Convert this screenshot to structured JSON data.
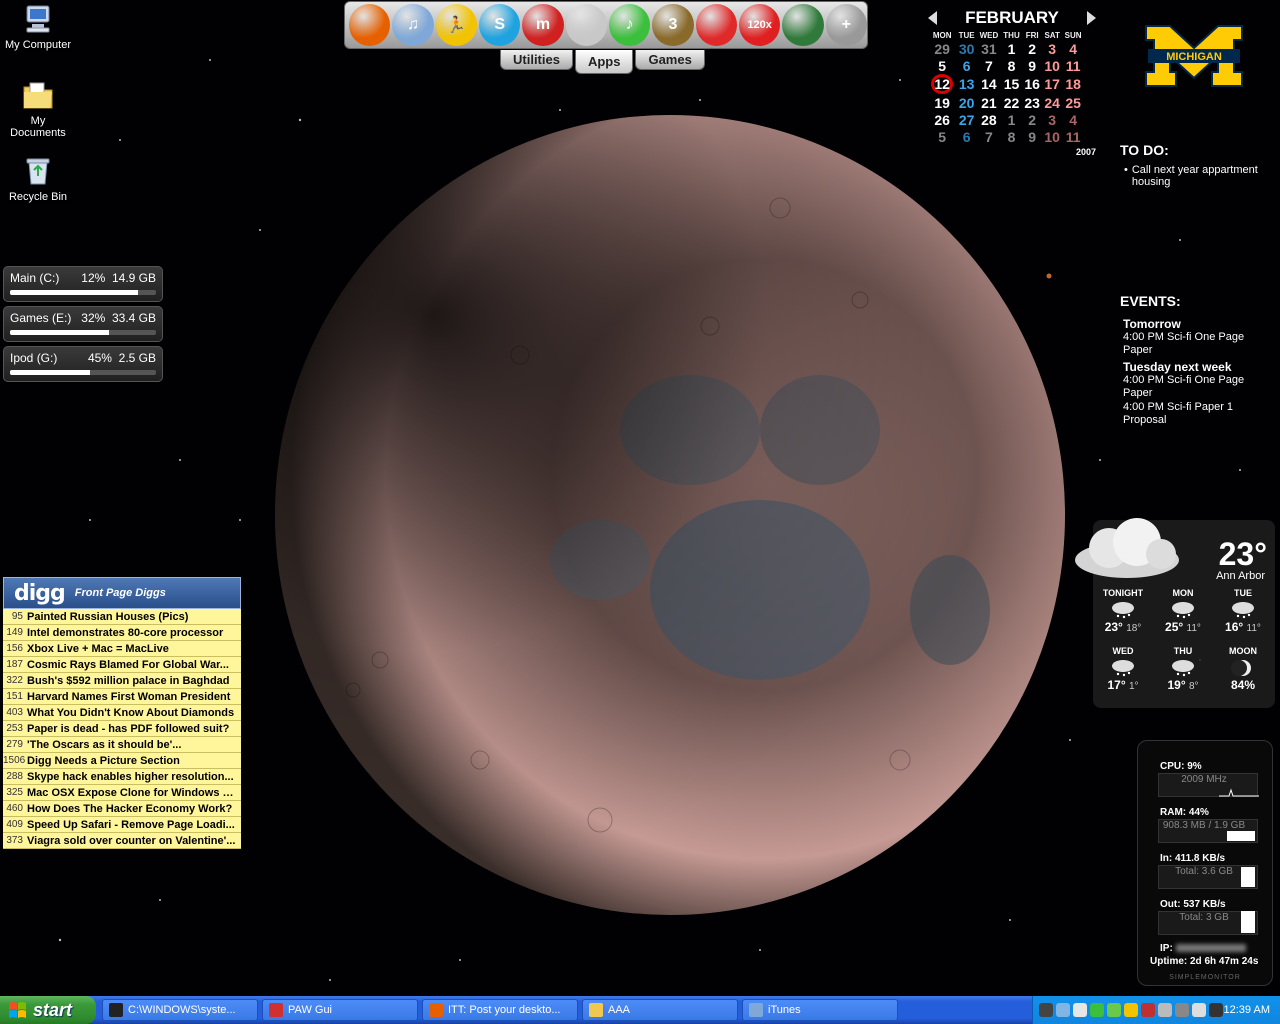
{
  "desktop_icons": [
    {
      "label": "My Computer",
      "icon": "my-computer-icon"
    },
    {
      "label": "My Documents",
      "icon": "my-documents-icon"
    },
    {
      "label": "Recycle Bin",
      "icon": "recycle-bin-icon"
    }
  ],
  "drives": [
    {
      "name": "Main (C:)",
      "percent_text": "12%",
      "size": "14.9 GB",
      "fill": 0.88
    },
    {
      "name": "Games (E:)",
      "percent_text": "32%",
      "size": "33.4 GB",
      "fill": 0.68
    },
    {
      "name": "Ipod (G:)",
      "percent_text": "45%",
      "size": "2.5 GB",
      "fill": 0.55
    }
  ],
  "digg": {
    "logo": "digg",
    "subtitle": "Front Page Diggs",
    "items": [
      {
        "count": "95",
        "title": "Painted Russian Houses (Pics)"
      },
      {
        "count": "149",
        "title": "Intel demonstrates 80-core processor"
      },
      {
        "count": "156",
        "title": "Xbox Live + Mac = MacLive"
      },
      {
        "count": "187",
        "title": "Cosmic Rays Blamed For Global War..."
      },
      {
        "count": "322",
        "title": "Bush's $592 million palace in Baghdad"
      },
      {
        "count": "151",
        "title": "Harvard Names First Woman President"
      },
      {
        "count": "403",
        "title": "What You Didn't Know About Diamonds"
      },
      {
        "count": "253",
        "title": "Paper is dead - has PDF followed suit?"
      },
      {
        "count": "279",
        "title": "'The Oscars as it should be'..."
      },
      {
        "count": "1506",
        "title": "Digg Needs a Picture Section"
      },
      {
        "count": "288",
        "title": "Skype hack enables higher resolution..."
      },
      {
        "count": "325",
        "title": "Mac OSX Expose Clone for Windows V..."
      },
      {
        "count": "460",
        "title": "How Does The Hacker Economy Work?"
      },
      {
        "count": "409",
        "title": "Speed Up Safari - Remove Page Loadi..."
      },
      {
        "count": "373",
        "title": "Viagra sold over counter on Valentine'..."
      }
    ]
  },
  "dock": {
    "apps": [
      {
        "name": "firefox-icon",
        "color": "#e66000",
        "glyph": ""
      },
      {
        "name": "itunes-icon",
        "color": "#7fa8d8",
        "glyph": "♫"
      },
      {
        "name": "aim-icon",
        "color": "#f2c300",
        "glyph": "🏃"
      },
      {
        "name": "skype-icon",
        "color": "#1fa3e0",
        "glyph": "S"
      },
      {
        "name": "mirc-icon",
        "color": "#d02020",
        "glyph": "m"
      },
      {
        "name": "headset-icon",
        "color": "#c8c8c8",
        "glyph": ""
      },
      {
        "name": "jetaudio-icon",
        "color": "#3cbf3c",
        "glyph": "♪"
      },
      {
        "name": "film-icon",
        "color": "#8a6a2a",
        "glyph": "3"
      },
      {
        "name": "audition-icon",
        "color": "#e02a2a",
        "glyph": ""
      },
      {
        "name": "acrobat-icon",
        "color": "#e02020",
        "glyph": "120x"
      },
      {
        "name": "globe-icon",
        "color": "#2f7a3a",
        "glyph": ""
      },
      {
        "name": "add-icon",
        "color": "#999999",
        "glyph": "+"
      }
    ],
    "tabs": [
      "Utilities",
      "Apps",
      "Games"
    ],
    "active_tab": "Apps"
  },
  "calendar": {
    "month": "FEBRUARY",
    "year": "2007",
    "weekdays": [
      "MON",
      "TUE",
      "WED",
      "THU",
      "FRI",
      "SAT",
      "SUN"
    ],
    "weeks": [
      [
        "29",
        "30",
        "31",
        "1",
        "2",
        "3",
        "4"
      ],
      [
        "5",
        "6",
        "7",
        "8",
        "9",
        "10",
        "11"
      ],
      [
        "12",
        "13",
        "14",
        "15",
        "16",
        "17",
        "18"
      ],
      [
        "19",
        "20",
        "21",
        "22",
        "23",
        "24",
        "25"
      ],
      [
        "26",
        "27",
        "28",
        "1",
        "2",
        "3",
        "4"
      ],
      [
        "5",
        "6",
        "7",
        "8",
        "9",
        "10",
        "11"
      ]
    ],
    "today": "12"
  },
  "umich_logo": "MICHIGAN",
  "todo": {
    "heading": "TO DO:",
    "items": [
      "Call next year appartment housing"
    ]
  },
  "events": {
    "heading": "EVENTS:",
    "groups": [
      {
        "when": "Tomorrow",
        "items": [
          "4:00 PM Sci-fi One Page Paper"
        ]
      },
      {
        "when": "Tuesday next week",
        "items": [
          "4:00 PM Sci-fi One Page Paper",
          "4:00 PM Sci-fi Paper 1 Proposal"
        ]
      }
    ]
  },
  "weather": {
    "current_temp": "23°",
    "city": "Ann Arbor",
    "forecast": [
      {
        "day": "TONIGHT",
        "hi": "23°",
        "lo": "18°",
        "icon": "snow-cloud-icon"
      },
      {
        "day": "MON",
        "hi": "25°",
        "lo": "11°",
        "icon": "snow-cloud-icon"
      },
      {
        "day": "TUE",
        "hi": "16°",
        "lo": "11°",
        "icon": "snow-cloud-icon"
      },
      {
        "day": "WED",
        "hi": "17°",
        "lo": "1°",
        "icon": "snow-cloud-icon"
      },
      {
        "day": "THU",
        "hi": "19°",
        "lo": "8°",
        "icon": "sun-cloud-icon"
      },
      {
        "day": "MOON",
        "hi": "84%",
        "lo": "",
        "icon": "moon-phase-icon"
      }
    ]
  },
  "sysmon": {
    "cpu": "CPU: 9%",
    "cpu_sub": "2009 MHz",
    "ram": "RAM: 44%",
    "ram_sub": "908.3 MB / 1.9 GB",
    "net_in": "In: 411.8 KB/s",
    "net_in_sub": "Total: 3.6 GB",
    "net_out": "Out: 537 KB/s",
    "net_out_sub": "Total: 3 GB",
    "ip_label": "IP:",
    "uptime": "Uptime: 2d 6h 47m 24s",
    "brand": "SIMPLEMONITOR"
  },
  "taskbar": {
    "start": "start",
    "tasks": [
      {
        "label": "C:\\WINDOWS\\syste...",
        "icon": "cmd-icon",
        "color": "#222222"
      },
      {
        "label": "PAW Gui",
        "icon": "paw-icon",
        "color": "#d03030"
      },
      {
        "label": "ITT: Post your deskto...",
        "icon": "firefox-icon",
        "color": "#e66000"
      },
      {
        "label": "AAA",
        "icon": "folder-icon",
        "color": "#f0c850"
      },
      {
        "label": "iTunes",
        "icon": "itunes-icon",
        "color": "#7fa8d8"
      }
    ],
    "clock": "12:39 AM"
  }
}
